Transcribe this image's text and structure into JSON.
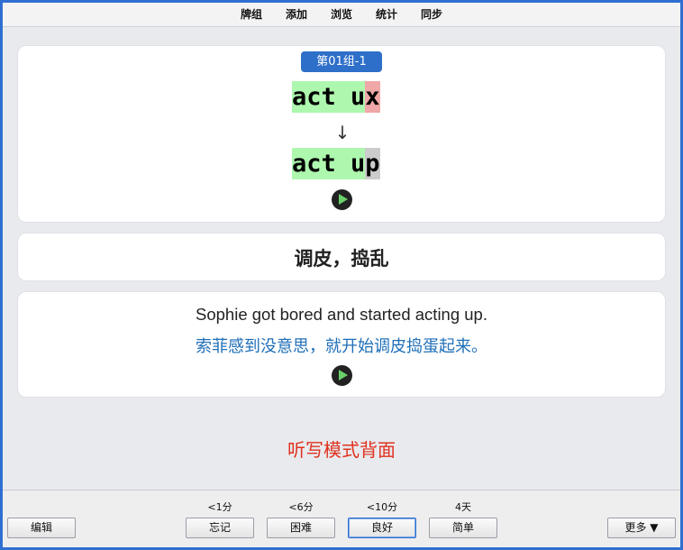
{
  "menu": [
    "牌组",
    "添加",
    "浏览",
    "统计",
    "同步"
  ],
  "card": {
    "deck_badge": "第01组-1",
    "typed": {
      "ok": "act u",
      "wrong": "x"
    },
    "arrow": "↓",
    "answer": {
      "ok": "act u",
      "missing": "p"
    },
    "meaning": "调皮，捣乱",
    "sentence_en": "Sophie got bored and started acting up.",
    "sentence_zh": "索菲感到没意思，就开始调皮捣蛋起来。",
    "dictation_label": "听写模式背面"
  },
  "bottom": {
    "edit_label": "编辑",
    "more_label": "更多 ▼",
    "answers": [
      {
        "interval": "<1分",
        "label": "忘记"
      },
      {
        "interval": "<6分",
        "label": "困难"
      },
      {
        "interval": "<10分",
        "label": "良好"
      },
      {
        "interval": "4天",
        "label": "简单"
      }
    ]
  },
  "colors": {
    "correct_bg": "#aef7ae",
    "wrong_bg": "#f0a7a7",
    "missing_bg": "#cccccc",
    "badge_bg": "#2e6fc9",
    "zh_text": "#1f6fb8",
    "dictation_text": "#e0321f"
  }
}
